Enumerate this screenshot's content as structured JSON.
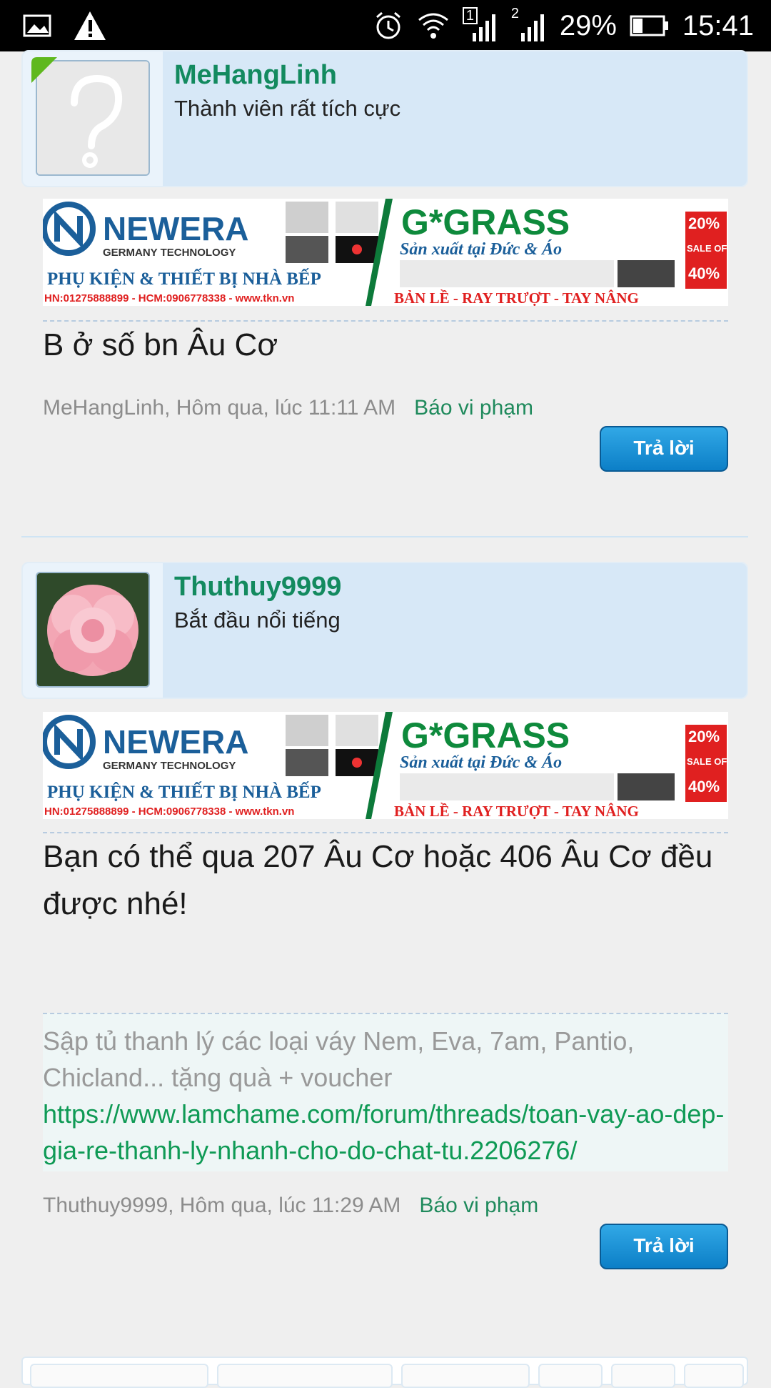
{
  "status_bar": {
    "sim1": "1",
    "sim2": "2",
    "battery": "29%",
    "time": "15:41"
  },
  "banner": {
    "brand_left": "NEWERA",
    "brand_left_sub": "GERMANY TECHNOLOGY",
    "left_tagline": "PHỤ KIỆN & THIẾT BỊ NHÀ BẾP",
    "left_contact": "HN:01275888899 - HCM:0906778338 - www.tkn.vn",
    "brand_right": "G*GRASS",
    "right_tagline": "Sản xuất tại Đức & Áo",
    "right_products": "BẢN LỀ - RAY TRƯỢT - TAY NÂNG",
    "sale_top": "20%",
    "sale_mid": "SALE OFF",
    "sale_bottom": "40%"
  },
  "posts": [
    {
      "username": "MeHangLinh",
      "user_title": "Thành viên rất tích cực",
      "message": "B ở số bn Âu Cơ",
      "meta": "MeHangLinh, Hôm qua, lúc 11:11 AM",
      "report_label": "Báo vi phạm",
      "reply_label": "Trả lời"
    },
    {
      "username": "Thuthuy9999",
      "user_title": "Bắt đầu nổi tiếng",
      "message": "Bạn có thể qua 207 Âu Cơ hoặc 406 Âu Cơ đều được nhé!",
      "signature_text": "Sập tủ thanh lý các loại váy Nem, Eva, 7am, Pantio, Chicland... tặng quà + voucher",
      "signature_link": "https://www.lamchame.com/forum/threads/toan-vay-ao-dep-gia-re-thanh-ly-nhanh-cho-do-chat-tu.2206276/",
      "meta": "Thuthuy9999, Hôm qua, lúc 11:29 AM",
      "report_label": "Báo vi phạm",
      "reply_label": "Trả lời"
    }
  ],
  "colors": {
    "accent_green": "#138a5f",
    "link_green": "#0f9a55",
    "button_blue": "#1a91d6",
    "author_bg": "#d7e8f7"
  }
}
